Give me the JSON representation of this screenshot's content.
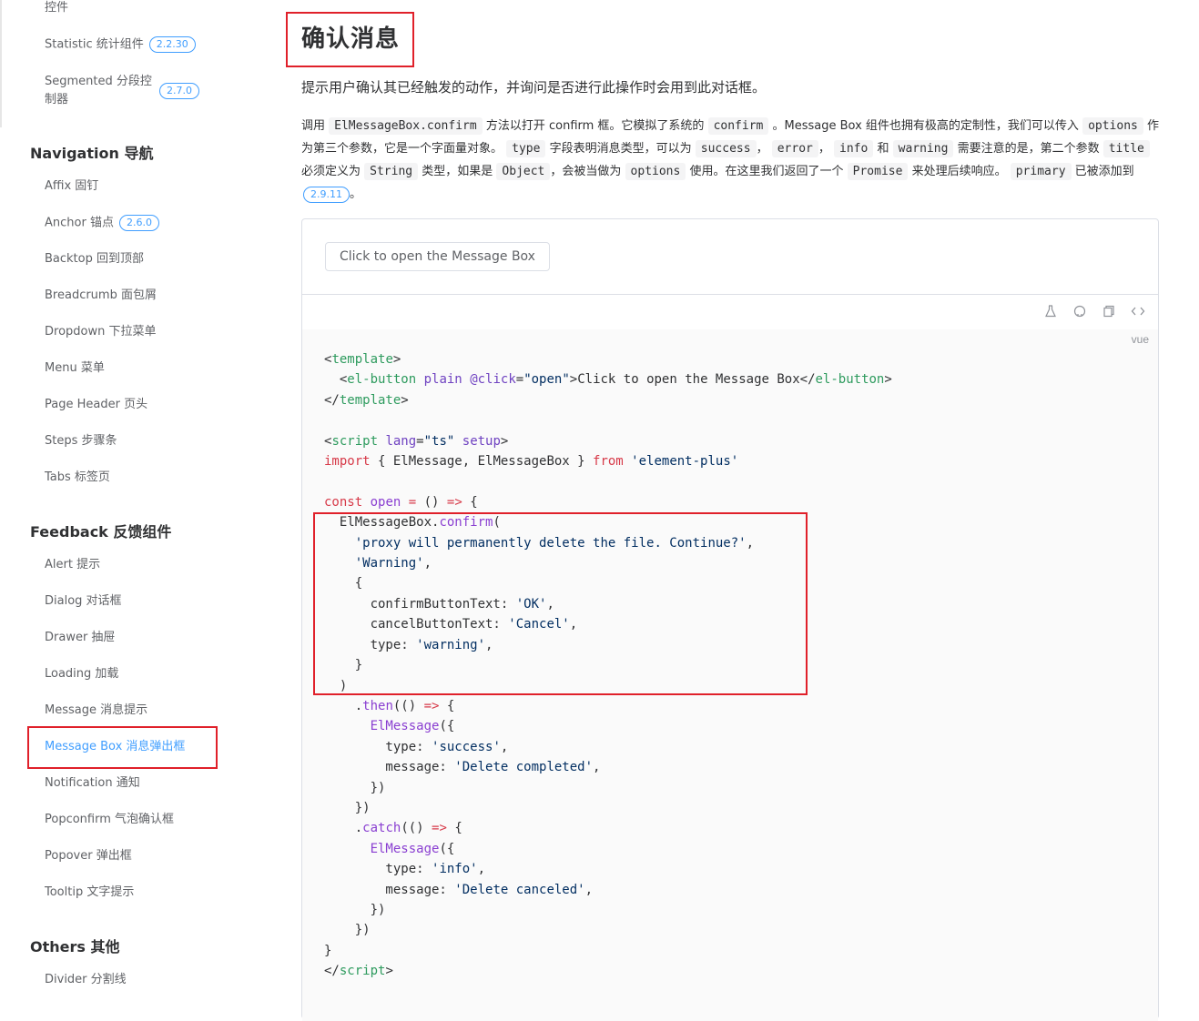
{
  "sidebar": {
    "top_items": [
      {
        "label": "控件",
        "badge": ""
      },
      {
        "label": "Statistic 统计组件",
        "badge": "2.2.30"
      },
      {
        "label": "Segmented 分段控制器",
        "badge": "2.7.0"
      }
    ],
    "groups": [
      {
        "title": "Navigation 导航",
        "items": [
          {
            "label": "Affix 固钉",
            "badge": ""
          },
          {
            "label": "Anchor 锚点",
            "badge": "2.6.0"
          },
          {
            "label": "Backtop 回到顶部",
            "badge": ""
          },
          {
            "label": "Breadcrumb 面包屑",
            "badge": ""
          },
          {
            "label": "Dropdown 下拉菜单",
            "badge": ""
          },
          {
            "label": "Menu 菜单",
            "badge": ""
          },
          {
            "label": "Page Header 页头",
            "badge": ""
          },
          {
            "label": "Steps 步骤条",
            "badge": ""
          },
          {
            "label": "Tabs 标签页",
            "badge": ""
          }
        ]
      },
      {
        "title": "Feedback 反馈组件",
        "items": [
          {
            "label": "Alert 提示",
            "badge": ""
          },
          {
            "label": "Dialog 对话框",
            "badge": ""
          },
          {
            "label": "Drawer 抽屉",
            "badge": ""
          },
          {
            "label": "Loading 加载",
            "badge": ""
          },
          {
            "label": "Message 消息提示",
            "badge": ""
          },
          {
            "label": "Message Box 消息弹出框",
            "badge": "",
            "active": true
          },
          {
            "label": "Notification 通知",
            "badge": ""
          },
          {
            "label": "Popconfirm 气泡确认框",
            "badge": ""
          },
          {
            "label": "Popover 弹出框",
            "badge": ""
          },
          {
            "label": "Tooltip 文字提示",
            "badge": ""
          }
        ]
      },
      {
        "title": "Others 其他",
        "items": [
          {
            "label": "Divider 分割线",
            "badge": ""
          }
        ]
      }
    ]
  },
  "main": {
    "title": "确认消息",
    "lead": "提示用户确认其已经触发的动作，并询问是否进行此操作时会用到此对话框。",
    "desc": {
      "p1": "调用",
      "c1": "ElMessageBox.confirm",
      "p2": "方法以打开 confirm 框。它模拟了系统的",
      "c2": "confirm",
      "p3": "。Message Box 组件也拥有极高的定制性，我们可以传入",
      "c3": "options",
      "p4": "作为第三个参数，它是一个字面量对象。",
      "c4": "type",
      "p5": "字段表明消息类型，可以为",
      "c5": "success",
      "p6": "，",
      "c6": "error",
      "p7": "，",
      "c7": "info",
      "p8": "和",
      "c8": "warning",
      "p9": "需要注意的是，第二个参数",
      "c9": "title",
      "p10": "必须定义为",
      "c10": "String",
      "p11": "类型，如果是",
      "c11": "Object",
      "p12": "，会被当做为",
      "c12": "options",
      "p13": "使用。在这里我们返回了一个",
      "c13": "Promise",
      "p14": "来处理后续响应。",
      "c14": "primary",
      "p15": "已被添加到",
      "badge": "2.9.11",
      "p16": "。"
    },
    "demo": {
      "button_label": "Click to open the Message Box",
      "lang_label": "vue",
      "toolbar_icons": [
        "flask-icon",
        "github-icon",
        "copy-icon",
        "code-icon"
      ]
    }
  },
  "colors": {
    "accent": "#409eff",
    "highlight_box": "#e0202a",
    "code_bg": "#fafafa"
  }
}
